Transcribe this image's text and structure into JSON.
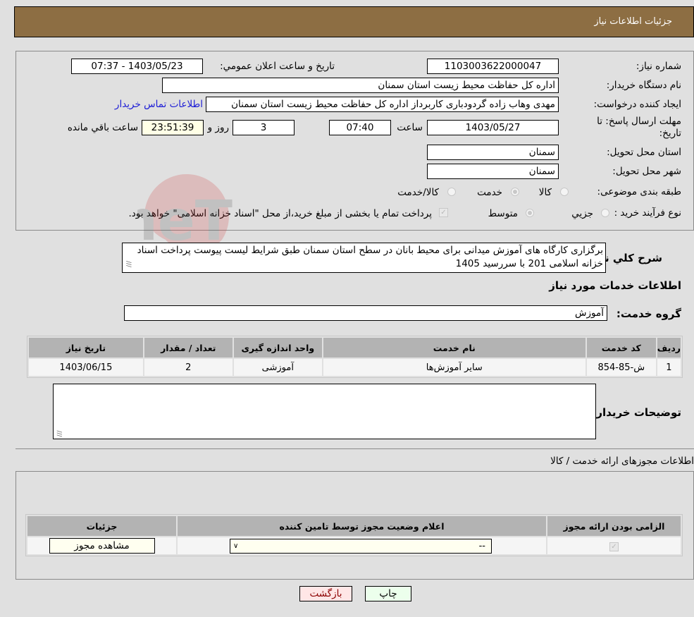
{
  "header": {
    "title": "جزئیات اطلاعات نیاز"
  },
  "need_info": {
    "need_number_label": "شماره نیاز:",
    "need_number": "1103003622000047",
    "announce_label": "تاریخ و ساعت اعلان عمومي:",
    "announce_value": "1403/05/23 - 07:37",
    "buyer_org_label": "نام دستگاه خریدار:",
    "buyer_org": "اداره کل حفاظت محیط زیست استان سمنان",
    "creator_label": "ایجاد کننده درخواست:",
    "creator": "مهدی وهاب زاده گردودباری کاربرداز اداره کل حفاظت محیط زیست استان سمنان",
    "contact_link": "اطلاعات تماس خریدار",
    "deadline_label": "مهلت ارسال پاسخ: تا تاریخ:",
    "deadline_date": "1403/05/27",
    "time_label": "ساعت",
    "deadline_time": "07:40",
    "days_value": "3",
    "days_label": "روز و",
    "remaining_value": "23:51:39",
    "remaining_label": "ساعت باقي مانده",
    "province_label": "استان محل تحویل:",
    "province": "سمنان",
    "city_label": "شهر محل تحویل:",
    "city": "سمنان",
    "category_label": "طبقه بندی موضوعی:",
    "category_options": [
      {
        "label": "کالا",
        "checked": false
      },
      {
        "label": "خدمت",
        "checked": true
      },
      {
        "label": "کالا/خدمت",
        "checked": false
      }
    ],
    "process_label": "نوع فرآیند خرید :",
    "process_options": [
      {
        "label": "جزيي",
        "checked": false
      },
      {
        "label": "متوسط",
        "checked": true
      }
    ],
    "treasury_checked": true,
    "treasury_text": "پرداخت تمام یا بخشی از مبلغ خرید،از محل \"اسناد خزانه اسلامی\" خواهد بود."
  },
  "description": {
    "label": "شرح کلي نیاز:",
    "text": "برگزاری کارگاه های آموزش میدانی برای محیط بانان در سطح استان سمنان طبق شرایط لیست پیوست پرداخت اسناد خزانه اسلامی 201 با سررسید 1405"
  },
  "services": {
    "section_title": "اطلاعات خدمات مورد نیاز",
    "group_label": "گروه خدمت:",
    "group_value": "آموزش",
    "columns": [
      "ردیف",
      "کد خدمت",
      "نام خدمت",
      "واحد اندازه گیری",
      "تعداد / مقدار",
      "تاریخ نیاز"
    ],
    "rows": [
      {
        "row": "1",
        "code": "ش-85-854",
        "name": "سایر آموزش‌ها",
        "unit": "آموزشی",
        "qty": "2",
        "date": "1403/06/15"
      }
    ]
  },
  "buyer_notes": {
    "label": "توضیحات خریدار:",
    "value": ""
  },
  "permits": {
    "section_title": "اطلاعات مجوزهای ارائه خدمت / کالا",
    "columns": [
      "الزامی بودن ارائه مجوز",
      "اعلام وضعیت مجوز توسط تامین کننده",
      "جزئیات"
    ],
    "rows": [
      {
        "required": true,
        "status_selected": "--",
        "details_button": "مشاهده مجوز"
      }
    ]
  },
  "footer": {
    "back_button": "بازگشت",
    "print_button": "چاپ"
  },
  "watermark": {
    "text": "AriaTender.neT"
  },
  "colors": {
    "header_bg": "#8d6e43",
    "link": "#1b1bd6",
    "back_bg": "#ffe6e6",
    "print_bg": "#ecffec"
  }
}
